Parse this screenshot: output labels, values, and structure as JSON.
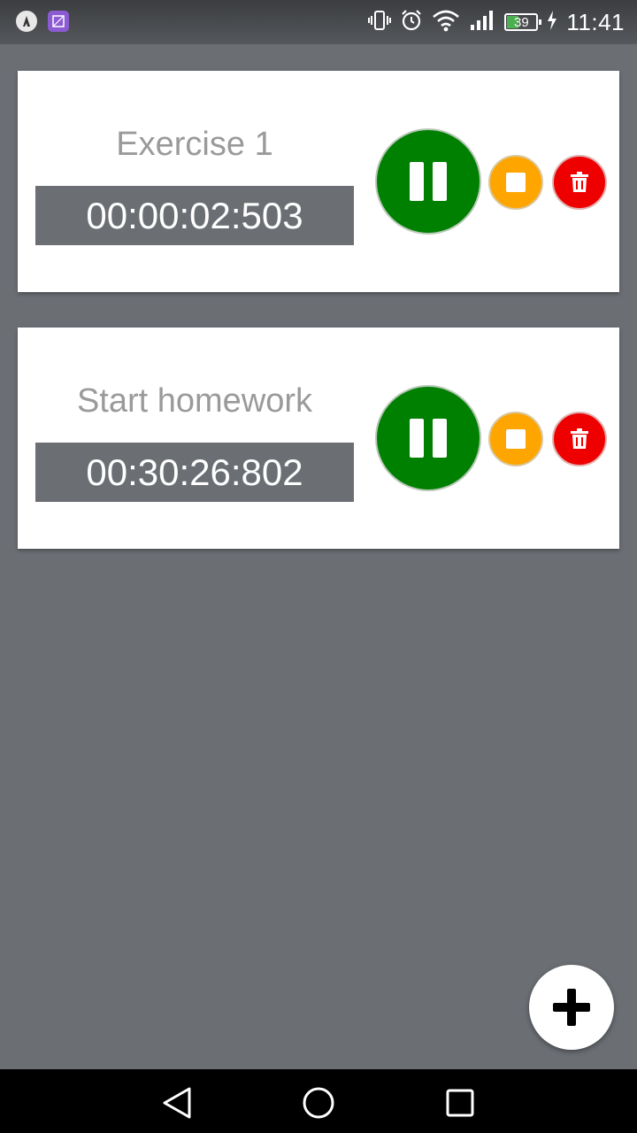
{
  "status_bar": {
    "battery_percent": "39",
    "time": "11:41"
  },
  "timers": [
    {
      "title": "Exercise 1",
      "elapsed": "00:00:02:503"
    },
    {
      "title": "Start homework",
      "elapsed": "00:30:26:802"
    }
  ],
  "colors": {
    "background": "#6b6f74",
    "pause": "#008000",
    "stop": "#ffa500",
    "delete": "#ee0000"
  },
  "icons": {
    "pause": "pause-icon",
    "stop": "stop-icon",
    "delete": "trash-icon",
    "add": "plus-icon"
  }
}
